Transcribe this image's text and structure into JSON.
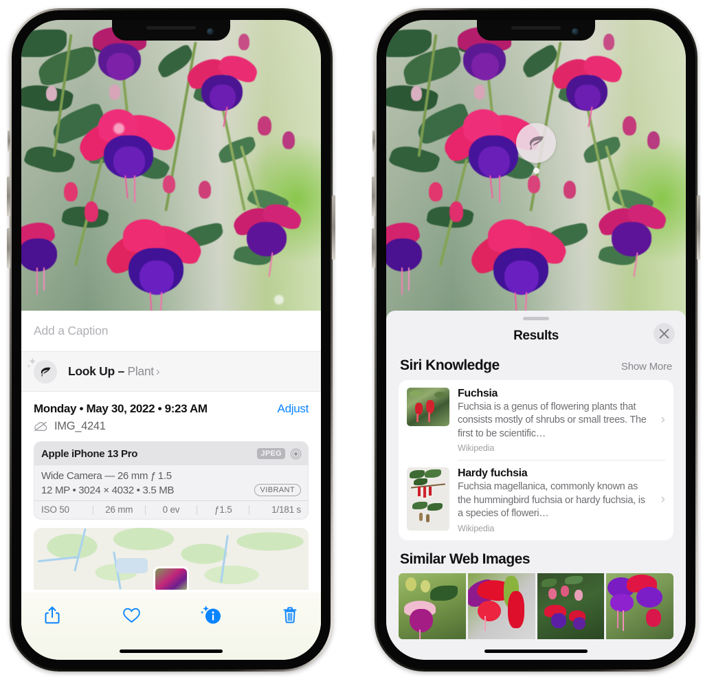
{
  "left_phone": {
    "caption_placeholder": "Add a Caption",
    "lookup": {
      "icon": "leaf-icon",
      "label": "Look Up –",
      "subject": "Plant",
      "chevron": "›"
    },
    "date_text": "Monday • May 30, 2022 • 9:23 AM",
    "adjust_label": "Adjust",
    "filename": "IMG_4241",
    "filename_icon": "cloud-slash-icon",
    "camera_card": {
      "model": "Apple iPhone 13 Pro",
      "format_badge": "JPEG",
      "hdr_icon": "hdr-aperture-icon",
      "lens_line": "Wide Camera — 26 mm ƒ 1.5",
      "size_line": "12 MP • 3024 × 4032 • 3.5 MB",
      "style_pill": "VIBRANT",
      "exif": [
        "ISO 50",
        "26 mm",
        "0 ev",
        "ƒ1.5",
        "1/181 s"
      ]
    },
    "toolbar": [
      {
        "name": "share-button",
        "icon": "share-icon"
      },
      {
        "name": "favorite-button",
        "icon": "heart-icon"
      },
      {
        "name": "info-button",
        "icon": "info-sparkle-icon"
      },
      {
        "name": "delete-button",
        "icon": "trash-icon"
      }
    ]
  },
  "right_phone": {
    "photo_badge_icon": "leaf-icon",
    "sheet_title": "Results",
    "close_icon": "close-icon",
    "sections": [
      {
        "title": "Siri Knowledge",
        "action": "Show More",
        "items": [
          {
            "title": "Fuchsia",
            "description": "Fuchsia is a genus of flowering plants that consists mostly of shrubs or small trees. The first to be scientific…",
            "source": "Wikipedia",
            "thumb": "fuchsia-red-flowers-thumb"
          },
          {
            "title": "Hardy fuchsia",
            "description": "Fuchsia magellanica, commonly known as the hummingbird fuchsia or hardy fuchsia, is a species of floweri…",
            "source": "Wikipedia",
            "thumb": "hardy-fuchsia-branch-thumb"
          }
        ]
      },
      {
        "title": "Similar Web Images",
        "images": [
          "fuchsia-pink-white-on-green",
          "fuchsia-red-closeup",
          "fuchsia-bush-pink-buds",
          "fuchsia-purple-magenta-cluster"
        ]
      }
    ]
  },
  "colors": {
    "accent_blue": "#0a84ff",
    "sheet_bg": "#f1f1f4",
    "card_bg": "#ffffff",
    "secondary_text": "#6e6e73",
    "tertiary_text": "#a1a1a6"
  }
}
